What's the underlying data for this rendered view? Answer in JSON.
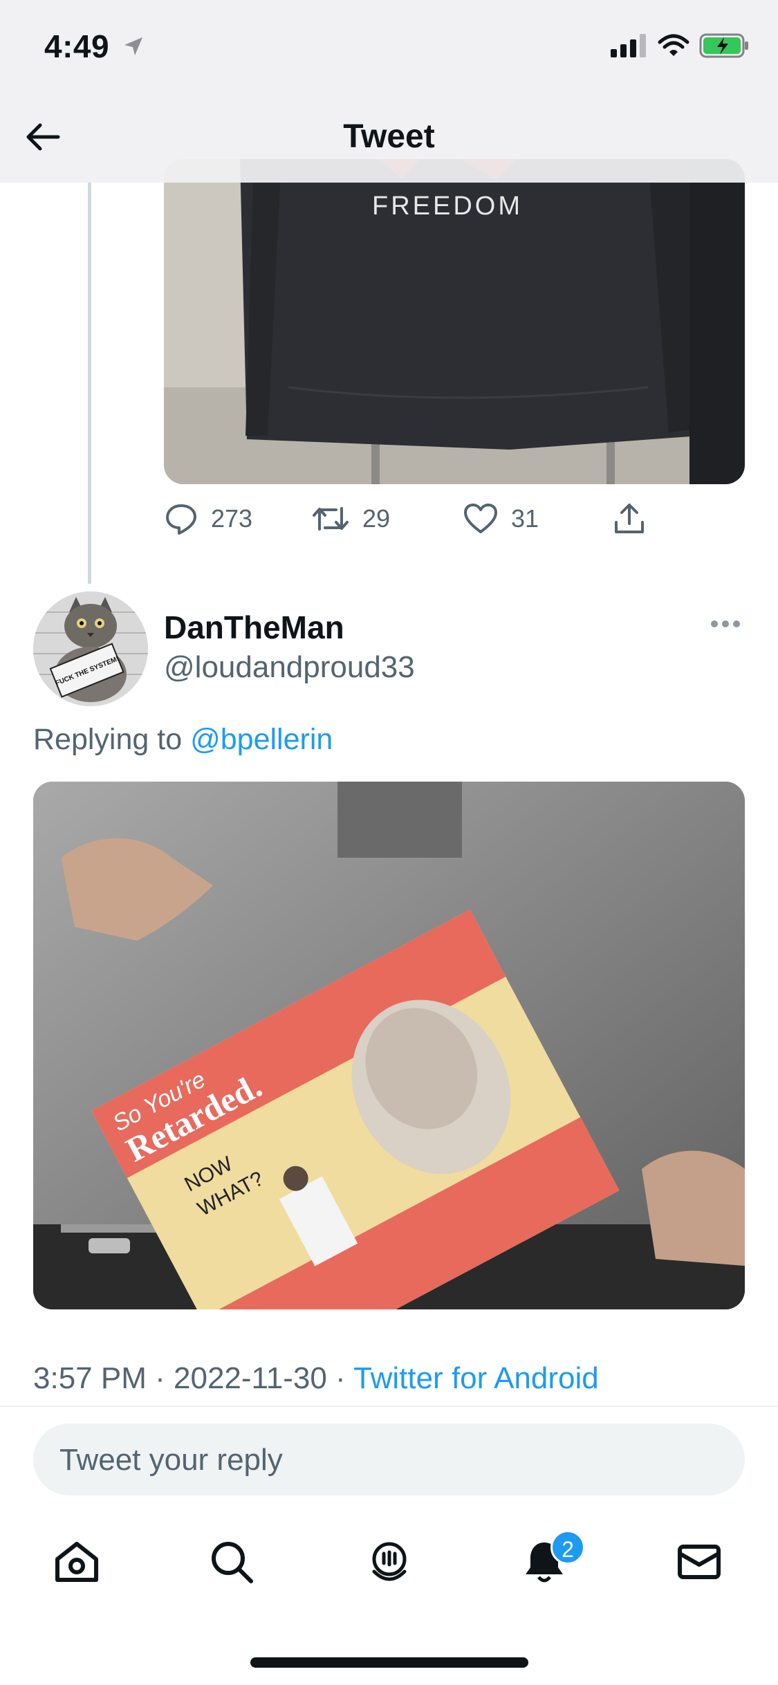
{
  "status_bar": {
    "time": "4:49",
    "icons": [
      "location-arrow-icon",
      "cellular-signal-icon",
      "wifi-icon",
      "battery-charging-icon"
    ]
  },
  "header": {
    "title": "Tweet",
    "back_icon": "arrow-left-icon"
  },
  "previous_tweet": {
    "media_text": "FREEDOM",
    "actions": {
      "reply_count": "273",
      "retweet_count": "29",
      "like_count": "31"
    }
  },
  "tweet": {
    "display_name": "DanTheMan",
    "handle": "@loudandproud33",
    "avatar_sign_text": "FUCK THE SYSTEM!",
    "replying_prefix": "Replying to",
    "replying_to": "@bpellerin",
    "media_text": {
      "line1": "So You're",
      "line2": "Retarded.",
      "line3": "NOW",
      "line4": "WHAT?"
    },
    "time": "3:57 PM",
    "date": "2022-11-30",
    "client": "Twitter for Android",
    "separator": "·"
  },
  "composer": {
    "placeholder": "Tweet your reply"
  },
  "bottom_nav": {
    "items": [
      "home-icon",
      "search-icon",
      "spaces-icon",
      "notifications-icon",
      "messages-icon"
    ],
    "notification_badge": "2"
  },
  "colors": {
    "accent": "#1d9bf0",
    "secondary_text": "#536471",
    "battery_green": "#34c759"
  }
}
